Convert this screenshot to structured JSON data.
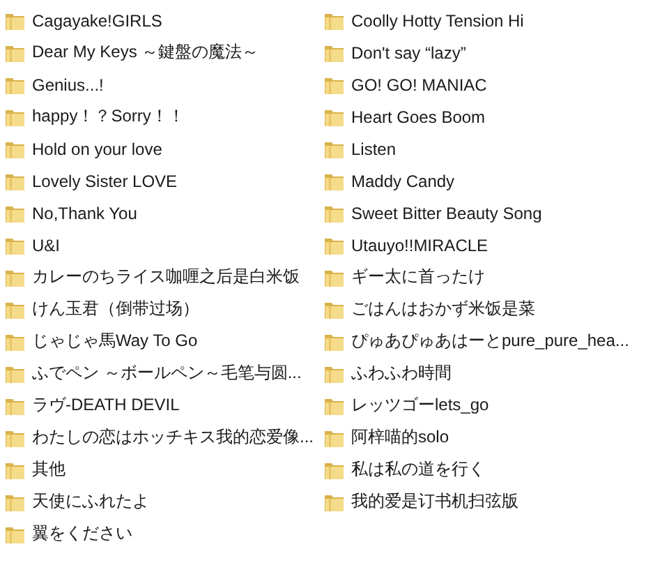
{
  "folders": [
    {
      "name": "Cagayake!GIRLS"
    },
    {
      "name": "Dear My Keys ～鍵盤の魔法～"
    },
    {
      "name": "Genius...!"
    },
    {
      "name": "happy！？Sorry！！"
    },
    {
      "name": "Hold on your love"
    },
    {
      "name": "Lovely Sister LOVE"
    },
    {
      "name": "No,Thank You"
    },
    {
      "name": "U&I"
    },
    {
      "name": "カレーのちライス咖喱之后是白米饭"
    },
    {
      "name": "けん玉君（倒带过场）"
    },
    {
      "name": "じゃじゃ馬Way To Go"
    },
    {
      "name": "ふでペン ～ボールペン～毛笔与圆..."
    },
    {
      "name": "ラヴ-DEATH DEVIL"
    },
    {
      "name": "わたしの恋はホッチキス我的恋爱像..."
    },
    {
      "name": "其他"
    },
    {
      "name": "天使にふれたよ"
    },
    {
      "name": "翼をください"
    },
    {
      "name": "Coolly Hotty Tension Hi"
    },
    {
      "name": "Don't say “lazy”"
    },
    {
      "name": "GO! GO! MANIAC"
    },
    {
      "name": "Heart Goes Boom"
    },
    {
      "name": "Listen"
    },
    {
      "name": "Maddy Candy"
    },
    {
      "name": "Sweet Bitter Beauty Song"
    },
    {
      "name": "Utauyo!!MIRACLE"
    },
    {
      "name": "ギー太に首ったけ"
    },
    {
      "name": "ごはんはおかず米饭是菜"
    },
    {
      "name": "ぴゅあぴゅあはーとpure_pure_hea..."
    },
    {
      "name": "ふわふわ時間"
    },
    {
      "name": "レッツゴーlets_go"
    },
    {
      "name": "阿梓喵的solo"
    },
    {
      "name": "私は私の道を行く"
    },
    {
      "name": "我的爱是订书机扫弦版"
    }
  ]
}
